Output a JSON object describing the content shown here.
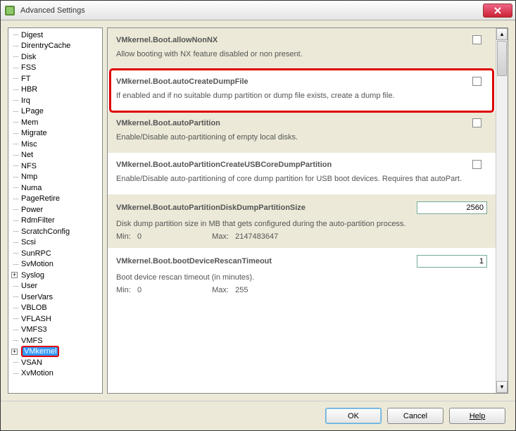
{
  "window": {
    "title": "Advanced Settings"
  },
  "tree": {
    "items": [
      {
        "label": "Digest"
      },
      {
        "label": "DirentryCache"
      },
      {
        "label": "Disk"
      },
      {
        "label": "FSS"
      },
      {
        "label": "FT"
      },
      {
        "label": "HBR"
      },
      {
        "label": "Irq"
      },
      {
        "label": "LPage"
      },
      {
        "label": "Mem"
      },
      {
        "label": "Migrate"
      },
      {
        "label": "Misc"
      },
      {
        "label": "Net"
      },
      {
        "label": "NFS"
      },
      {
        "label": "Nmp"
      },
      {
        "label": "Numa"
      },
      {
        "label": "PageRetire"
      },
      {
        "label": "Power"
      },
      {
        "label": "RdmFilter"
      },
      {
        "label": "ScratchConfig"
      },
      {
        "label": "Scsi"
      },
      {
        "label": "SunRPC"
      },
      {
        "label": "SvMotion"
      },
      {
        "label": "Syslog",
        "expandable": true
      },
      {
        "label": "User"
      },
      {
        "label": "UserVars"
      },
      {
        "label": "VBLOB"
      },
      {
        "label": "VFLASH"
      },
      {
        "label": "VMFS3"
      },
      {
        "label": "VMFS"
      },
      {
        "label": "VMkernel",
        "expandable": true,
        "selected": true,
        "highlighted": true
      },
      {
        "label": "VSAN"
      },
      {
        "label": "XvMotion"
      }
    ]
  },
  "settings": [
    {
      "name": "VMkernel.Boot.allowNonNX",
      "desc": "Allow booting with NX feature disabled or non present.",
      "type": "check",
      "checked": false
    },
    {
      "name": "VMkernel.Boot.autoCreateDumpFile",
      "desc": "If enabled and if no suitable dump partition or dump file exists, create a dump file.",
      "type": "check",
      "checked": false,
      "highlighted": true
    },
    {
      "name": "VMkernel.Boot.autoPartition",
      "desc": "Enable/Disable auto-partitioning of empty local disks.",
      "type": "check",
      "checked": false
    },
    {
      "name": "VMkernel.Boot.autoPartitionCreateUSBCoreDumpPartition",
      "desc": "Enable/Disable auto-partitioning of core dump partition for USB boot devices. Requires that autoPart.",
      "type": "check",
      "checked": false
    },
    {
      "name": "VMkernel.Boot.autoPartitionDiskDumpPartitionSize",
      "desc": "Disk dump partition size in MB that gets configured during the auto-partition process.",
      "type": "text",
      "value": "2560",
      "min": "0",
      "max": "2147483647"
    },
    {
      "name": "VMkernel.Boot.bootDeviceRescanTimeout",
      "desc": "Boot device rescan timeout (in minutes).",
      "type": "text",
      "value": "1",
      "min": "0",
      "max": "255"
    }
  ],
  "buttons": {
    "ok": "OK",
    "cancel": "Cancel",
    "help": "Help"
  },
  "labels": {
    "min": "Min:",
    "max": "Max:"
  }
}
